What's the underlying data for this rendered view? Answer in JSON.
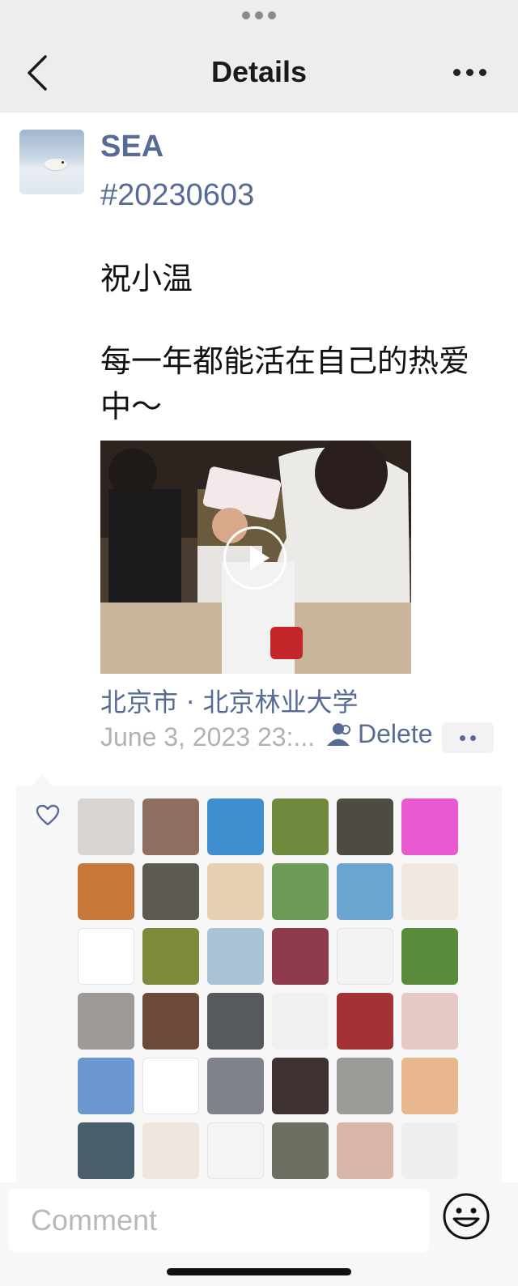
{
  "header": {
    "title": "Details"
  },
  "post": {
    "username": "SEA",
    "hashtag": "#20230603",
    "text_lines": [
      "祝小温",
      "每一年都能活在自己的热爱",
      "中～"
    ],
    "location": "北京市 · 北京林业大学",
    "timestamp": "June 3, 2023 23:...",
    "delete_label": "Delete"
  },
  "likes": {
    "count_shown": 36,
    "avatar_colors": [
      "#d9d4cf",
      "#8c6f5e",
      "#3f8fd0",
      "#6d8a3f",
      "#4e4a44",
      "#e85ad0",
      "#c6793b",
      "#5c5a52",
      "#e7d0b2",
      "#6e9a55",
      "#6aa4cf",
      "#efe9e2",
      "#ffffff",
      "#7c8a3c",
      "#a9c3d6",
      "#8f3a4e",
      "#f3f3f3",
      "#5a8a3c",
      "#9f9a95",
      "#6b4a3a",
      "#565a5e",
      "#eef0f2",
      "#a23236",
      "#e6c9c3",
      "#6b97cf",
      "#ffffff",
      "#7e8489",
      "#3d3230",
      "#9b9a97",
      "#e9b78d",
      "#4a5d6a",
      "#ede6e0",
      "#f4f4f4",
      "#6d6e62",
      "#d8b7a8",
      "#f0efee"
    ]
  },
  "composer": {
    "placeholder": "Comment"
  },
  "colors": {
    "link": "#576b95",
    "header_bg": "#ededed",
    "muted": "#b2b2b2"
  }
}
